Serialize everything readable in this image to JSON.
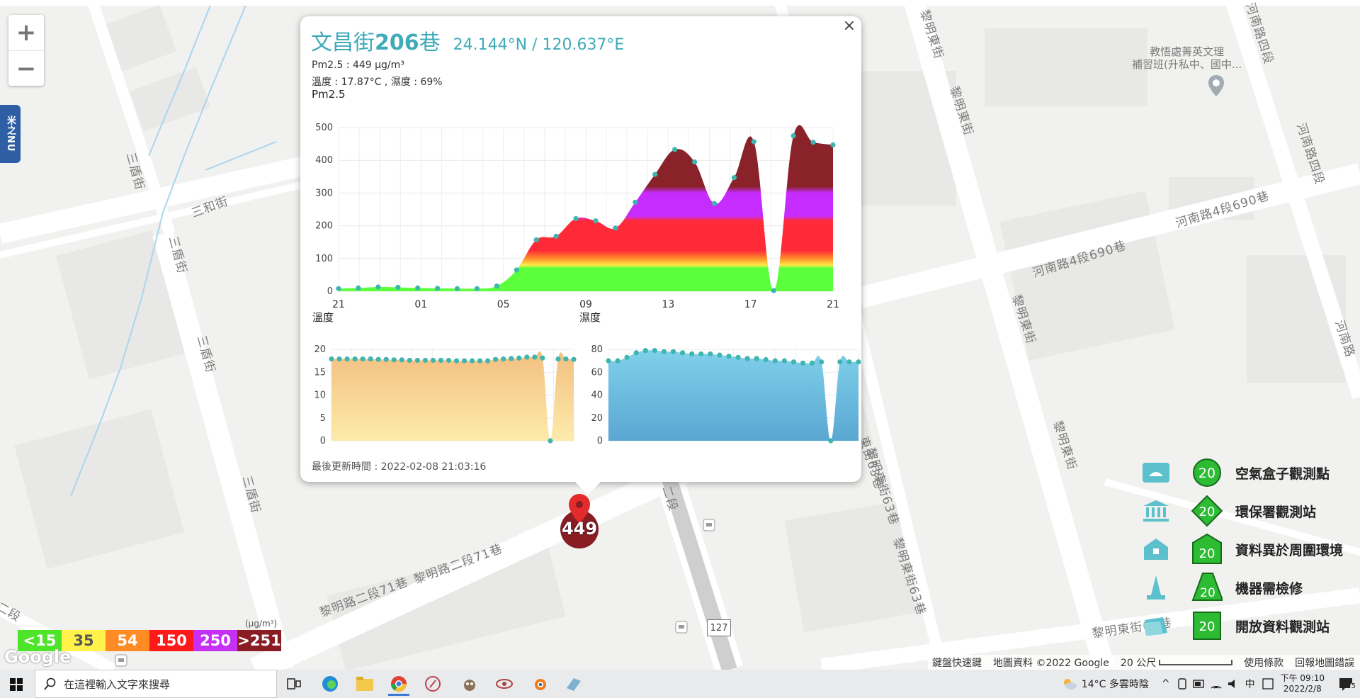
{
  "map": {
    "zoom_in": "+",
    "zoom_out": "−",
    "side_tab": "米之NU",
    "streets": [
      {
        "text": "三和街"
      },
      {
        "text": "三盾街"
      },
      {
        "text": "三盾街"
      },
      {
        "text": "三盾街"
      },
      {
        "text": "三盾街"
      },
      {
        "text": "黎明東街"
      },
      {
        "text": "黎明東街"
      },
      {
        "text": "黎明東街"
      },
      {
        "text": "黎明東街"
      },
      {
        "text": "河南路4段690巷"
      },
      {
        "text": "河南路4段690巷"
      },
      {
        "text": "河南路四段"
      },
      {
        "text": "河南路四段"
      },
      {
        "text": "河南路"
      },
      {
        "text": "黎明路二段71巷"
      },
      {
        "text": "黎明路二段71巷"
      },
      {
        "text": "黎明東街63巷"
      },
      {
        "text": "黎明東街63巷"
      },
      {
        "text": "東街63巷"
      },
      {
        "text": "黎明東街63巷"
      },
      {
        "text": "二段"
      },
      {
        "text": "二段"
      }
    ],
    "poi": "教悟處菁英文理\n補習班(升私中、國中...",
    "route_shield": "127",
    "marker_value": "449"
  },
  "popup": {
    "close": "×",
    "title_prefix": "文昌街",
    "title_number": "206",
    "title_suffix": "巷",
    "coordinates": "24.144°N / 120.637°E",
    "pm25_line": "Pm2.5 : 449 μg/m³",
    "temp_humid_line": "溫度 : 17.87°C , 濕度 : 69%",
    "pm_chart_title": "Pm2.5",
    "temp_chart_title": "溫度",
    "humid_chart_title": "濕度",
    "updated": "最後更新時間 : 2022-02-08 21:03:16"
  },
  "chart_data": [
    {
      "type": "area",
      "title": "Pm2.5",
      "x": [
        0,
        1,
        2,
        3,
        4,
        5,
        6,
        7,
        8,
        9,
        10,
        11,
        12,
        13,
        14,
        15,
        16,
        17,
        18,
        19,
        20,
        21,
        22,
        23,
        24
      ],
      "values": [
        8,
        10,
        13,
        12,
        10,
        9,
        8,
        8,
        16,
        65,
        157,
        168,
        222,
        215,
        193,
        272,
        357,
        433,
        395,
        268,
        347,
        457,
        2,
        475,
        455,
        447
      ],
      "x_ticks": [
        "21",
        "01",
        "05",
        "09",
        "13",
        "17",
        "21"
      ],
      "y_ticks": [
        0,
        100,
        200,
        300,
        400,
        500
      ],
      "ylim": [
        0,
        500
      ],
      "grid": true,
      "colors": {
        "good": "#5bff3c",
        "moderate": "#ffe94a",
        "usg": "#ff8e2a",
        "unhealthy": "#ff2a38",
        "very_unhealthy": "#c72cff",
        "hazardous": "#8a2229"
      },
      "point_color": "#3fb5b0"
    },
    {
      "type": "area",
      "title": "溫度",
      "values": [
        17.9,
        17.9,
        17.9,
        17.9,
        17.9,
        17.9,
        17.8,
        17.8,
        17.7,
        17.7,
        17.6,
        17.6,
        17.6,
        17.6,
        17.6,
        17.6,
        17.5,
        17.5,
        17.5,
        17.5,
        17.5,
        17.8,
        17.9,
        18.0,
        18.1,
        18.3,
        18.3,
        18.1,
        0.0,
        17.9,
        17.9,
        17.8
      ],
      "y_ticks": [
        0,
        5,
        10,
        15,
        20
      ],
      "ylim": [
        0,
        20
      ],
      "fill_top": "#f2bf80",
      "fill_bottom": "#fdebab"
    },
    {
      "type": "area",
      "title": "濕度",
      "values": [
        70,
        70,
        73,
        77,
        79,
        79,
        78,
        78,
        77,
        76,
        76,
        76,
        75,
        74,
        73,
        72,
        72,
        71,
        70,
        70,
        69,
        68,
        68,
        69,
        0,
        69,
        69,
        69
      ],
      "y_ticks": [
        0,
        20,
        40,
        60,
        80
      ],
      "ylim": [
        0,
        80
      ],
      "fill_top": "#7fd0ea",
      "fill_bottom": "#5aa7d3"
    }
  ],
  "pm_legend": {
    "unit": "(μg/m³)",
    "items": [
      {
        "label": "<15",
        "color": "#4ee42a"
      },
      {
        "label": "35",
        "color": "#fff24a"
      },
      {
        "label": "54",
        "color": "#ff8b25"
      },
      {
        "label": "150",
        "color": "#ff1a1a"
      },
      {
        "label": "250",
        "color": "#c62ff5"
      },
      {
        "label": ">251",
        "color": "#8a1c24"
      }
    ]
  },
  "site_legend": {
    "badge_value": "20",
    "items": [
      {
        "label": "空氣盒子觀測點"
      },
      {
        "label": "環保署觀測站"
      },
      {
        "label": "資料異於周圍環境"
      },
      {
        "label": "機器需檢修"
      },
      {
        "label": "開放資料觀測站"
      }
    ]
  },
  "attribution": {
    "shortcuts": "鍵盤快速鍵",
    "data": "地圖資料 ©2022 Google",
    "scale": "20 公尺",
    "terms": "使用條款",
    "report": "回報地圖錯誤"
  },
  "google_logo": "Google",
  "taskbar": {
    "search_placeholder": "在這裡輸入文字來搜尋",
    "weather": "14°C 多雲時陰",
    "ime": "中",
    "time": "下午 09:10",
    "date": "2022/2/8",
    "notification_count": "5"
  }
}
